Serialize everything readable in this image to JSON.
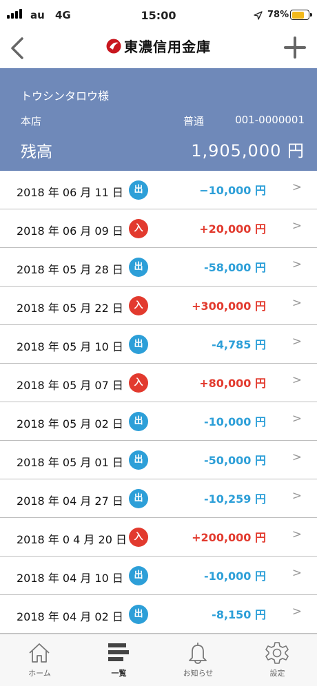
{
  "status_bar": {
    "carrier": "au",
    "network": "4G",
    "time": "15:00",
    "battery_pct": "78%",
    "battery_color": "#f2b91c"
  },
  "nav": {
    "back_icon": "chevron-left-icon",
    "logo_name": "東濃信用金庫",
    "add_icon": "plus-icon"
  },
  "account": {
    "holder": "トウシンタロウ様",
    "branch": "本店",
    "type": "普通",
    "number": "001-0000001",
    "balance_label": "残高",
    "balance_value": "1,905,000 円",
    "bg_color": "#6f89b9"
  },
  "transactions": [
    {
      "date": "2018 年 06 月 11 日",
      "badge": "出",
      "kind": "out",
      "amount": "−10,000 円"
    },
    {
      "date": "2018 年 06 月 09 日",
      "badge": "入",
      "kind": "in",
      "amount": "+20,000 円"
    },
    {
      "date": "2018 年 05 月 28 日",
      "badge": "出",
      "kind": "out",
      "amount": "-58,000 円"
    },
    {
      "date": "2018 年 05 月 22 日",
      "badge": "入",
      "kind": "in",
      "amount": "+300,000 円"
    },
    {
      "date": "2018 年 05 月 10 日",
      "badge": "出",
      "kind": "out",
      "amount": "-4,785 円"
    },
    {
      "date": "2018 年 05 月 07 日",
      "badge": "入",
      "kind": "in",
      "amount": "+80,000 円"
    },
    {
      "date": "2018 年 05 月 02 日",
      "badge": "出",
      "kind": "out",
      "amount": "-10,000 円"
    },
    {
      "date": "2018 年 05 月 01 日",
      "badge": "出",
      "kind": "out",
      "amount": "-50,000 円"
    },
    {
      "date": "2018 年 04 月 27 日",
      "badge": "出",
      "kind": "out",
      "amount": "-10,259 円"
    },
    {
      "date": "2018 年 0 4 月 20 日",
      "badge": "入",
      "kind": "in",
      "amount": "+200,000 円"
    },
    {
      "date": "2018 年 04 月 10 日",
      "badge": "出",
      "kind": "out",
      "amount": "-10,000 円"
    },
    {
      "date": "2018 年 04 月 02 日",
      "badge": "出",
      "kind": "out",
      "amount": "-8,150 円"
    }
  ],
  "colors": {
    "out": "#2d9fd8",
    "in": "#e23a2e"
  },
  "tabs": [
    {
      "label": "ホーム",
      "icon": "home-icon"
    },
    {
      "label": "一覧",
      "icon": "list-icon",
      "active": true
    },
    {
      "label": "お知らせ",
      "icon": "bell-icon"
    },
    {
      "label": "設定",
      "icon": "gear-icon"
    }
  ]
}
